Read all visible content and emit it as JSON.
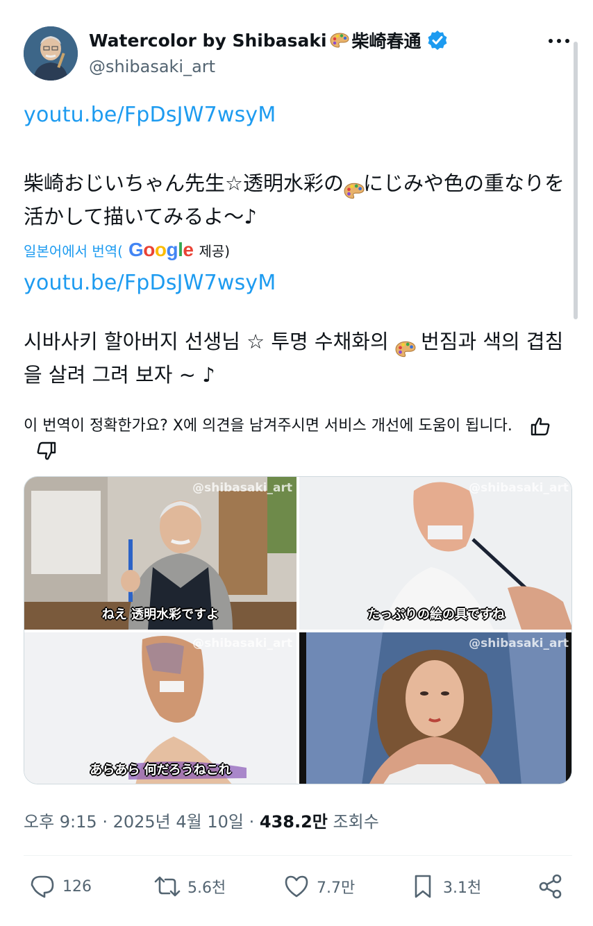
{
  "author": {
    "display_name": "Watercolor by Shibasaki",
    "display_name_jp": "柴崎春通",
    "handle": "@shibasaki_art"
  },
  "tweet": {
    "link_1": "youtu.be/FpDsJW7wsyM",
    "text_jp": "柴崎おじいちゃん先生☆透明水彩の🎨にじみや色の重なりを活かして描いてみるよ〜♪",
    "text_jp_before": "柴崎おじいちゃん先生☆透明水彩の",
    "text_jp_after": "にじみや色の重なりを活かして描いてみるよ〜♪",
    "translated_prefix": "일본어에서 번역(",
    "translated_suffix": " 제공)",
    "link_2": "youtu.be/FpDsJW7wsyM",
    "text_ko_before": "시바사키 할아버지 선생님 ☆ 투명 수채화의 ",
    "text_ko_after": " 번짐과 색의 겹침을 살려 그려 보자 ~ ♪",
    "feedback_text": "이 번역이 정확한가요? X에 의견을 남겨주시면 서비스 개선에 도움이 됩니다."
  },
  "media": [
    {
      "watermark": "@shibasaki_art",
      "subtitle": "ねえ 透明水彩ですよ"
    },
    {
      "watermark": "@shibasaki_art",
      "subtitle": "たっぷりの絵の具ですね"
    },
    {
      "watermark": "@shibasaki_art",
      "subtitle": "あらあら 何だろうねこれ"
    },
    {
      "watermark": "@shibasaki_art",
      "subtitle": ""
    }
  ],
  "meta": {
    "time": "오후 9:15",
    "date": "2025년 4월 10일",
    "views": "438.2만",
    "views_label": "조회수"
  },
  "actions": {
    "replies": "126",
    "reposts": "5.6천",
    "likes": "7.7만",
    "bookmarks": "3.1천"
  },
  "icons": [
    "avatar",
    "palette-emoji-icon",
    "verified-badge-icon",
    "more-icon",
    "thumbs-up-icon",
    "thumbs-down-icon",
    "reply-icon",
    "repost-icon",
    "like-icon",
    "bookmark-icon",
    "share-icon"
  ],
  "colors": {
    "link": "#1d9bf0",
    "verified": "#1d9bf0",
    "muted": "#536471",
    "text": "#0f1419"
  }
}
